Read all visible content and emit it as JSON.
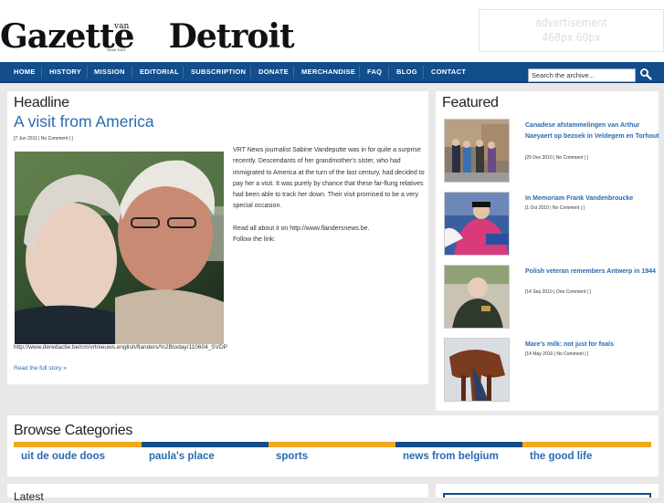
{
  "header": {
    "logo_text": "Gazette Detroit",
    "logo_van": "van",
    "logo_since": "Since 1914",
    "ad_line1": "advertisement",
    "ad_line2": "468px 60px"
  },
  "nav": {
    "items": [
      "HOME",
      "HISTORY",
      "MISSION",
      "EDITORIAL",
      "SUBSCRIPTION",
      "DONATE",
      "MERCHANDISE",
      "FAQ",
      "BLOG",
      "CONTACT"
    ],
    "search_placeholder": "Search the archive...",
    "search_value": "Search the archive..."
  },
  "headline": {
    "section_label": "Headline",
    "title": "A visit from America",
    "meta": "[7 Jun 2011 | No Comment | ]",
    "body_p1": "VRT News journalist Sabine Vandeputte was in for quite a surprise recently. Descendants of her grandmother's sister, who had immigrated to America at the turn of the last century, had decided to pay her a visit. It was purely by chance that these far-flung relatives had been able to track her down. Their visit promised to be a very special occasion.",
    "body_p2": "Read all about it on http://www.flandersnews.be.",
    "body_p3": "Follow the link:",
    "caption": "http://www.deredactie.be/cm/vrtnieuws.english/flanders/%2Btoday/110604_SVDP",
    "read_more": "Read the full story »"
  },
  "featured": {
    "section_label": "Featured",
    "items": [
      {
        "title": "Canadese afstammelingen van Arthur Naeyaert op bezoek in Veldegem en Torhout",
        "meta": "[29 Dec 2010 | No Comment | ]"
      },
      {
        "title": "In Memoriam Frank Vandenbroucke",
        "meta": "[1 Oct 2010 | No Comment | ]"
      },
      {
        "title": "Polish veteran remembers Antwerp in 1944",
        "meta": "[14 Sep 2010 | One Comment | ]"
      },
      {
        "title": "Mare's milk: not just for foals",
        "meta": "[14 May 2010 | No Comment | ]"
      }
    ]
  },
  "browse": {
    "section_label": "Browse Categories",
    "categories": [
      {
        "name": "uit de oude doos",
        "color": "#f2a81d"
      },
      {
        "name": "paula's place",
        "color": "#124d8c"
      },
      {
        "name": "sports",
        "color": "#f2a81d"
      },
      {
        "name": "news from belgium",
        "color": "#124d8c"
      },
      {
        "name": "the good life",
        "color": "#f2a81d"
      }
    ]
  },
  "bottom": {
    "left_label": "Latest"
  },
  "colors": {
    "nav_bg": "#124d8c",
    "link": "#2a6bb0",
    "accent_gold": "#f2a81d",
    "page_bg": "#e8e8e8"
  },
  "icons": {
    "search": "magnifier-icon"
  }
}
